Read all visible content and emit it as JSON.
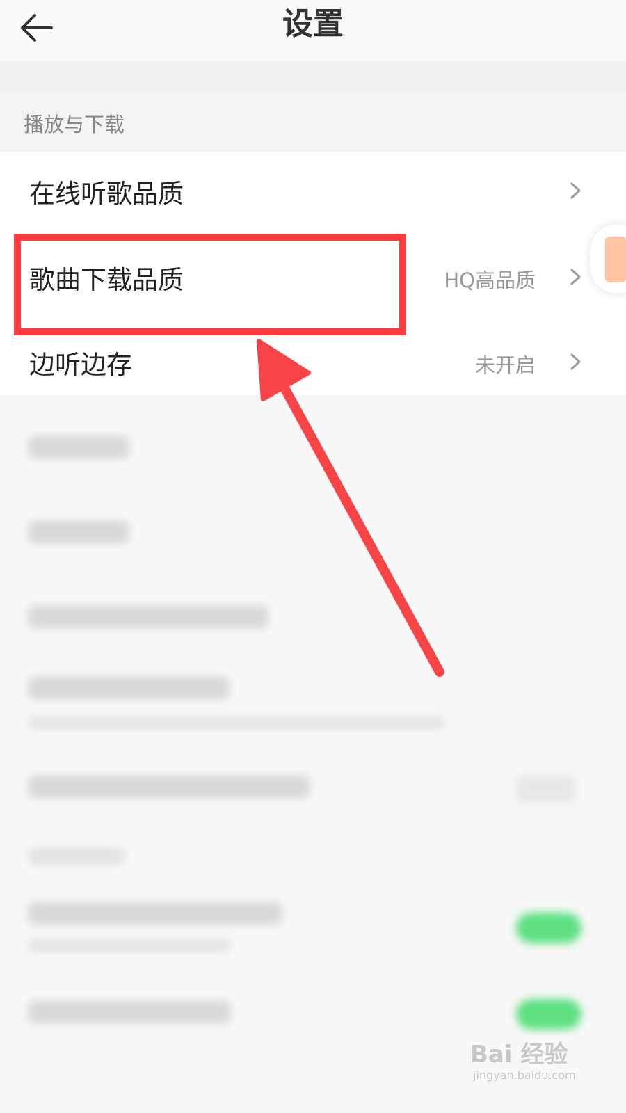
{
  "header": {
    "title": "设置",
    "back_icon": "arrow-left-icon"
  },
  "section": {
    "title": "播放与下载"
  },
  "rows": [
    {
      "label": "在线听歌品质",
      "value": ""
    },
    {
      "label": "歌曲下载品质",
      "value": "HQ高品质"
    },
    {
      "label": "边听边存",
      "value": "未开启"
    }
  ],
  "annotation": {
    "color": "#ff3b3b"
  },
  "watermark": {
    "brand": "Bai  经验",
    "url": "jingyan.baidu.com"
  }
}
